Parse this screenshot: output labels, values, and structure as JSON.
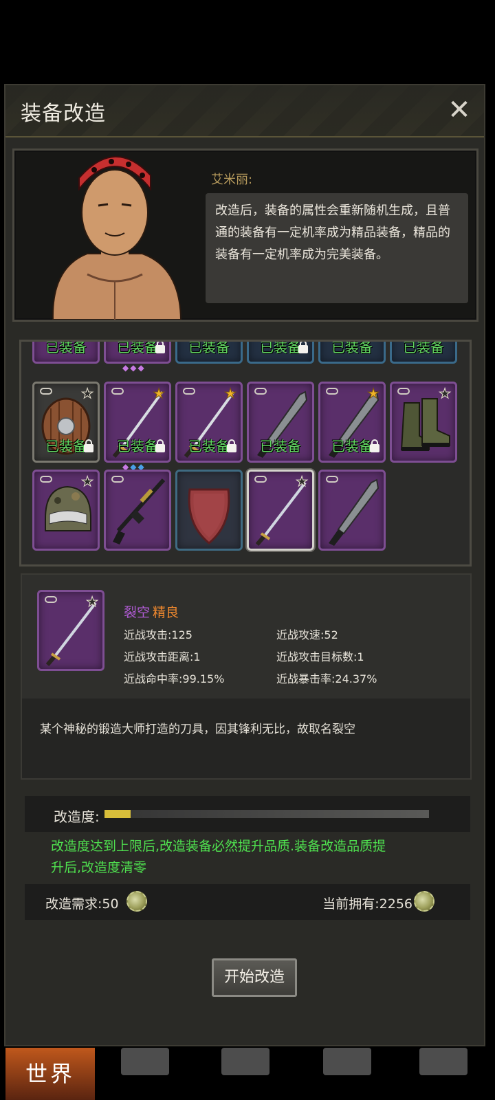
{
  "title": "装备改造",
  "npc": {
    "name": "艾米丽:",
    "dialog": "改造后，装备的属性会重新随机生成，且普通的装备有一定机率成为精品装备，精品的装备有一定机率成为完美装备。"
  },
  "inventory": {
    "equipped_label": "已装备",
    "slots_row1": [
      "purple",
      "purple",
      "blue",
      "blue",
      "blue",
      "blue"
    ],
    "slots_row2": [
      {
        "item": "round-shield",
        "star": "outline",
        "equipped": true,
        "locked": true,
        "rarity": "gray"
      },
      {
        "item": "katana",
        "star": "gold",
        "equipped": true,
        "locked": true,
        "rarity": "purple",
        "gems": "◆◆◆"
      },
      {
        "item": "katana",
        "star": "gold",
        "equipped": true,
        "locked": true,
        "rarity": "purple"
      },
      {
        "item": "machete",
        "star": "none",
        "equipped": true,
        "locked": false,
        "rarity": "purple"
      },
      {
        "item": "machete",
        "star": "gold",
        "equipped": true,
        "locked": true,
        "rarity": "purple"
      },
      {
        "item": "combat-boots",
        "star": "outline",
        "equipped": false,
        "locked": false,
        "rarity": "purple"
      }
    ],
    "slots_row3": [
      {
        "item": "helmet",
        "star": "outline",
        "rarity": "purple"
      },
      {
        "item": "assault-rifle",
        "star": "none",
        "rarity": "purple"
      },
      {
        "item": "kite-shield",
        "star": "none",
        "rarity": "blue"
      },
      {
        "item": "katana",
        "star": "outline",
        "rarity": "purple",
        "selected": true
      },
      {
        "item": "machete",
        "star": "none",
        "rarity": "purple"
      }
    ]
  },
  "detail": {
    "name": "裂空",
    "quality": "精良",
    "stats": {
      "melee_attack": "近战攻击:125",
      "melee_speed": "近战攻速:52",
      "melee_range": "近战攻击距离:1",
      "melee_targets": "近战攻击目标数:1",
      "melee_hit": "近战命中率:99.15%",
      "melee_crit": "近战暴击率:24.37%"
    },
    "description": "某个神秘的锻造大师打造的刀具，因其锋利无比，故取名裂空"
  },
  "upgrade": {
    "progress_label": "改造度:",
    "progress_fraction": 0.08,
    "note_line1": "改造度达到上限后,改造装备必然提升品质.装备改造品质提",
    "note_line2": "升后,改造度清零",
    "requirement": "改造需求:50",
    "owned": "当前拥有:2256",
    "start_button": "开始改造"
  },
  "bottom_nav": {
    "world": "世界"
  },
  "colors": {
    "equipped_green": "#62d562",
    "quality_orange": "#f1892e",
    "name_purple": "#b35cd8",
    "note_green": "#4fe04f"
  }
}
